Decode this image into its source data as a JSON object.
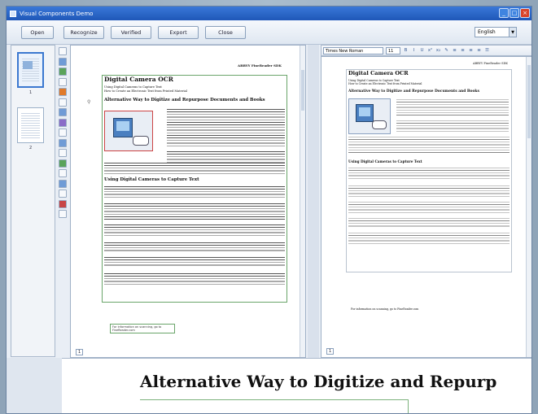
{
  "window": {
    "title": "Visual Components Demo"
  },
  "toolbar": {
    "buttons": [
      "Open",
      "Recognize",
      "Verified",
      "Export",
      "Close"
    ],
    "language": "English"
  },
  "thumbnails": [
    {
      "label": "1"
    },
    {
      "label": "2"
    }
  ],
  "format_bar": {
    "font": "Times New Roman",
    "size": "11"
  },
  "left_page": {
    "header_right": "ABBYY FineReader SDK",
    "title": "Digital Camera OCR",
    "subtitle_1": "Using Digital Cameras to Capture Text",
    "subtitle_2": "How to Create an Electronic Text from Printed Material",
    "h2_alt": "Alternative Way to Digitize and Repurpose Documents and Books",
    "h2_use": "Using Digital Cameras to Capture Text",
    "footer": "For information on scanning, go to FineReader.com",
    "page_number": "1"
  },
  "right_page": {
    "header_right": "ABBYY FineReader SDK",
    "title": "Digital Camera OCR",
    "subtitle_1": "Using Digital Cameras to Capture Text",
    "subtitle_2": "How to Create an Electronic Text from Printed Material",
    "h2_alt": "Alternative Way to Digitize and Repurpose Documents and Books",
    "h2_use": "Using Digital Cameras to Capture Text",
    "footer": "For information on scanning, go to FineReader.com",
    "page_number": "1"
  },
  "zoom": {
    "text": "Alternative Way to Digitize and Repurp"
  }
}
